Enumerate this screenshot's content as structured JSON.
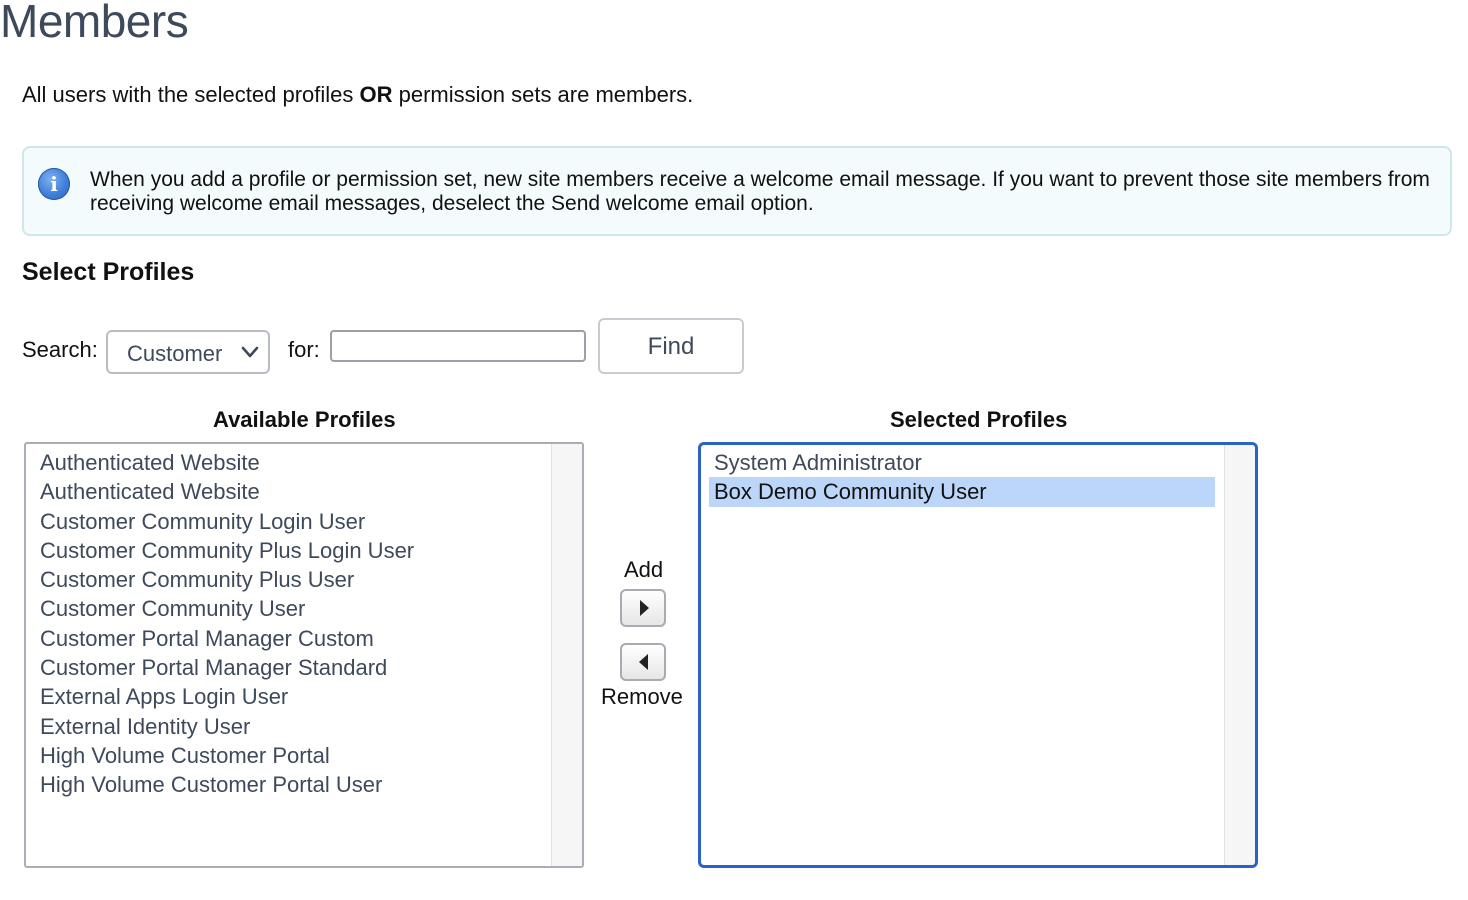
{
  "page": {
    "title": "Members",
    "intro_before": "All users with the selected profiles ",
    "intro_bold": "OR",
    "intro_after": " permission sets are members."
  },
  "info": {
    "icon": "info-icon",
    "icon_glyph": "i",
    "text": "When you add a profile or permission set, new site members receive a welcome email message. If you want to prevent those site members from receiving welcome email messages, deselect the Send welcome email option."
  },
  "section": {
    "title": "Select Profiles"
  },
  "search": {
    "label": "Search:",
    "select_value": "Customer",
    "for_label": "for:",
    "input_value": "",
    "find_label": "Find"
  },
  "available": {
    "header": "Available Profiles",
    "items": [
      "Authenticated Website",
      "Authenticated Website",
      "Customer Community Login User",
      "Customer Community Plus Login User",
      "Customer Community Plus User",
      "Customer Community User",
      "Customer Portal Manager Custom",
      "Customer Portal Manager Standard",
      "External Apps Login User",
      "External Identity User",
      "High Volume Customer Portal",
      "High Volume Customer Portal User"
    ]
  },
  "selected": {
    "header": "Selected Profiles",
    "items": [
      "System Administrator",
      "Box Demo Community User"
    ],
    "highlighted_index": 1
  },
  "transfer": {
    "add_label": "Add",
    "remove_label": "Remove"
  },
  "colors": {
    "title": "#3e4a5c",
    "highlight": "#bcd6f9",
    "focus_border": "#2a62c9",
    "info_bg": "#f4fbfc"
  }
}
